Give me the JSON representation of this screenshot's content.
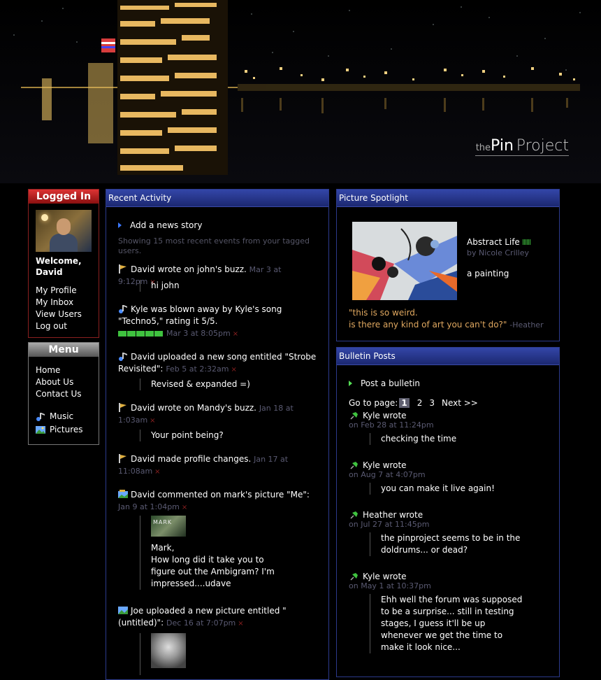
{
  "site": {
    "logo_the": "the",
    "logo_pin": "Pin",
    "logo_project": "Project"
  },
  "logged_in": {
    "title": "Logged In",
    "welcome": "Welcome,",
    "user_name": "David",
    "links": [
      "My Profile",
      "My Inbox",
      "View Users",
      "Log out"
    ]
  },
  "menu": {
    "title": "Menu",
    "links": [
      "Home",
      "About Us",
      "Contact Us"
    ],
    "media_links": [
      {
        "label": "Music",
        "icon": "music-icon"
      },
      {
        "label": "Pictures",
        "icon": "pictures-icon"
      }
    ]
  },
  "recent_activity": {
    "title": "Recent Activity",
    "add_link": "Add a news story",
    "showing": "Showing 15 most recent events from your tagged users.",
    "events": [
      {
        "icon": "buzz-icon",
        "text": "David wrote on john's buzz.",
        "time": "Mar 3 at 9:12pm",
        "quote": "hi john"
      },
      {
        "icon": "song-icon",
        "text": "Kyle was blown away by Kyle's song \"Techno5,\" rating it 5/5.",
        "time": "Mar 3 at 8:05pm",
        "rating": 5
      },
      {
        "icon": "song-icon",
        "text": "David uploaded a new song entitled \"Strobe Revisited\":",
        "time": "Feb 5 at 2:32am",
        "quote": "Revised & expanded =)"
      },
      {
        "icon": "buzz-icon",
        "text": "David wrote on Mandy's buzz.",
        "time": "Jan 18 at 1:03am",
        "quote": "Your point being?"
      },
      {
        "icon": "buzz-icon",
        "text": "David made profile changes.",
        "time": "Jan 17 at 11:08am"
      },
      {
        "icon": "picture-comment-icon",
        "text": "David commented on mark's picture \"Me\":",
        "time": "Jan 9 at 1:04pm",
        "thumb_text": "MARK",
        "quote": "Mark,\nHow long did it take you to figure out the Ambigram? I'm impressed....udave"
      },
      {
        "icon": "picture-upload-icon",
        "text": "Joe uploaded a new picture entitled \"(untitled)\":",
        "time": "Dec 16 at 7:07pm"
      }
    ],
    "remove_mark": "×"
  },
  "spotlight": {
    "title": "Picture Spotlight",
    "picture_title": "Abstract Life",
    "by": "by Nicole Crilley",
    "description": "a painting",
    "quote_line1": "\"this is so weird.",
    "quote_line2": "is there any kind of art you can't do?\"",
    "quote_author": "-Heather"
  },
  "bulletins": {
    "title": "Bulletin Posts",
    "post_link": "Post a bulletin",
    "goto_label": "Go to page:",
    "pages": [
      "1",
      "2",
      "3"
    ],
    "current_page": "1",
    "next_label": "Next >>",
    "posts": [
      {
        "author": "Kyle wrote",
        "time": "on Feb 28 at 11:24pm",
        "body": "checking the time"
      },
      {
        "author": "Kyle wrote",
        "time": "on Aug 7 at 4:07pm",
        "body": "you can make it live again!"
      },
      {
        "author": "Heather wrote",
        "time": "on Jul 27 at 11:45pm",
        "body": "the pinproject seems to be in the doldrums... or dead?"
      },
      {
        "author": "Kyle wrote",
        "time": "on May 1 at 10:37pm",
        "body": "Ehh well the forum was supposed to be a surprise... still in testing stages, I guess it'll be up whenever we get the time to make it look nice..."
      }
    ]
  },
  "colors": {
    "panel_blue": "#2c3a8c",
    "logged_red": "#8a2020",
    "timestamp": "#5a5a72",
    "quote_orange": "#e0a860",
    "rating_green": "#3fc23f"
  }
}
